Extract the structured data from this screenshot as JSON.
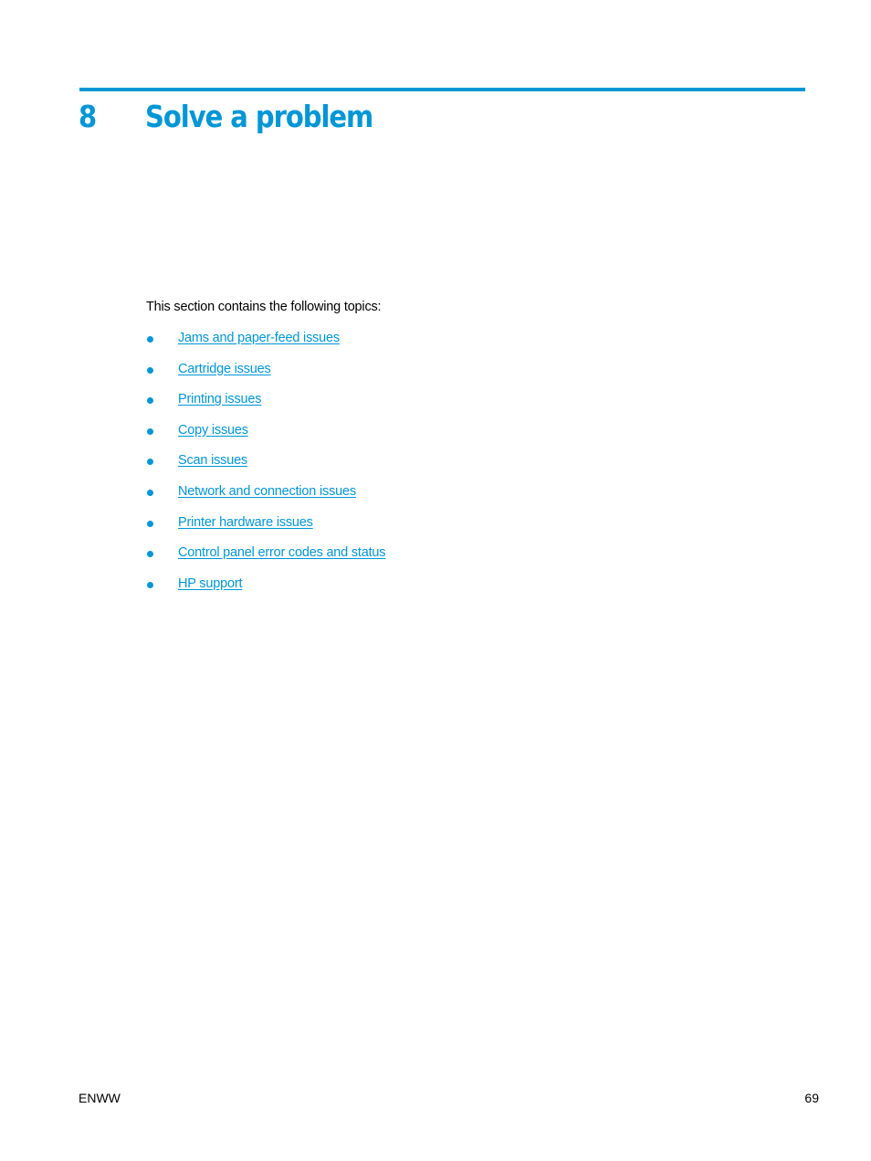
{
  "chapter": {
    "number": "8",
    "title": "Solve a problem"
  },
  "intro": "This section contains the following topics:",
  "topics": [
    {
      "label": "Jams and paper-feed issues"
    },
    {
      "label": "Cartridge issues"
    },
    {
      "label": "Printing issues"
    },
    {
      "label": "Copy issues"
    },
    {
      "label": "Scan issues"
    },
    {
      "label": "Network and connection issues"
    },
    {
      "label": "Printer hardware issues"
    },
    {
      "label": "Control panel error codes and status"
    },
    {
      "label": "HP support"
    }
  ],
  "footer": {
    "left": "ENWW",
    "page_number": "69"
  },
  "colors": {
    "accent": "#0096d6",
    "text": "#000000"
  }
}
